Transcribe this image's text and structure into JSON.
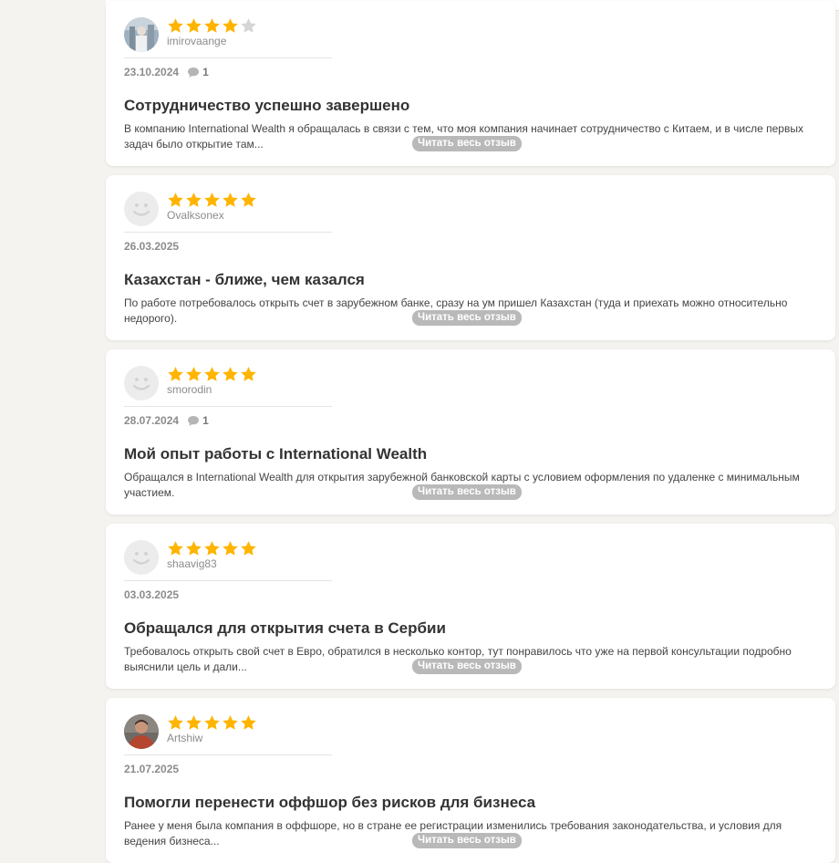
{
  "colors": {
    "star": "#ffb400",
    "star_empty": "#d5d5d5",
    "read_more_bg": "#b9b9b9",
    "page_bg": "#f4f3ef"
  },
  "read_more_label": "Читать весь отзыв",
  "reviews": [
    {
      "author": "imirovaange",
      "rating": 4,
      "date": "23.10.2024",
      "comments": "1",
      "title": "Сотрудничество успешно завершено",
      "excerpt": "В компанию International Wealth я обращалась в связи с тем, что моя компания начинает сотрудничество с Китаем, и в числе первых задач было открытие там...",
      "avatar": "photo-icon"
    },
    {
      "author": "Ovalksonex",
      "rating": 5,
      "date": "26.03.2025",
      "comments": "",
      "title": "Казахстан - ближе, чем казался",
      "excerpt": "По работе потребовалось открыть счет в зарубежном банке, сразу на ум пришел Казахстан (туда и приехать можно относительно недорого).",
      "avatar": "smiley-icon"
    },
    {
      "author": "smorodin",
      "rating": 5,
      "date": "28.07.2024",
      "comments": "1",
      "title": "Мой опыт работы с International Wealth",
      "excerpt": "Обращался в International Wealth для открытия зарубежной банковской карты с условием оформления по удаленке с минимальным участием.",
      "avatar": "smiley-icon"
    },
    {
      "author": "shaavig83",
      "rating": 5,
      "date": "03.03.2025",
      "comments": "",
      "title": "Обращался для открытия счета в Сербии",
      "excerpt": "Требовалось открыть свой счет в Евро, обратился в несколько контор, тут понравилось что уже на первой консультации подробно выяснили цель и дали...",
      "avatar": "smiley-icon"
    },
    {
      "author": "Artshiw",
      "rating": 5,
      "date": "21.07.2025",
      "comments": "",
      "title": "Помогли перенести оффшор без рисков для бизнеса",
      "excerpt": "Ранее у меня была компания в оффшоре, но в стране ее регистрации изменились требования законодательства, и условия для ведения бизнеса...",
      "avatar": "person-photo-icon"
    }
  ]
}
